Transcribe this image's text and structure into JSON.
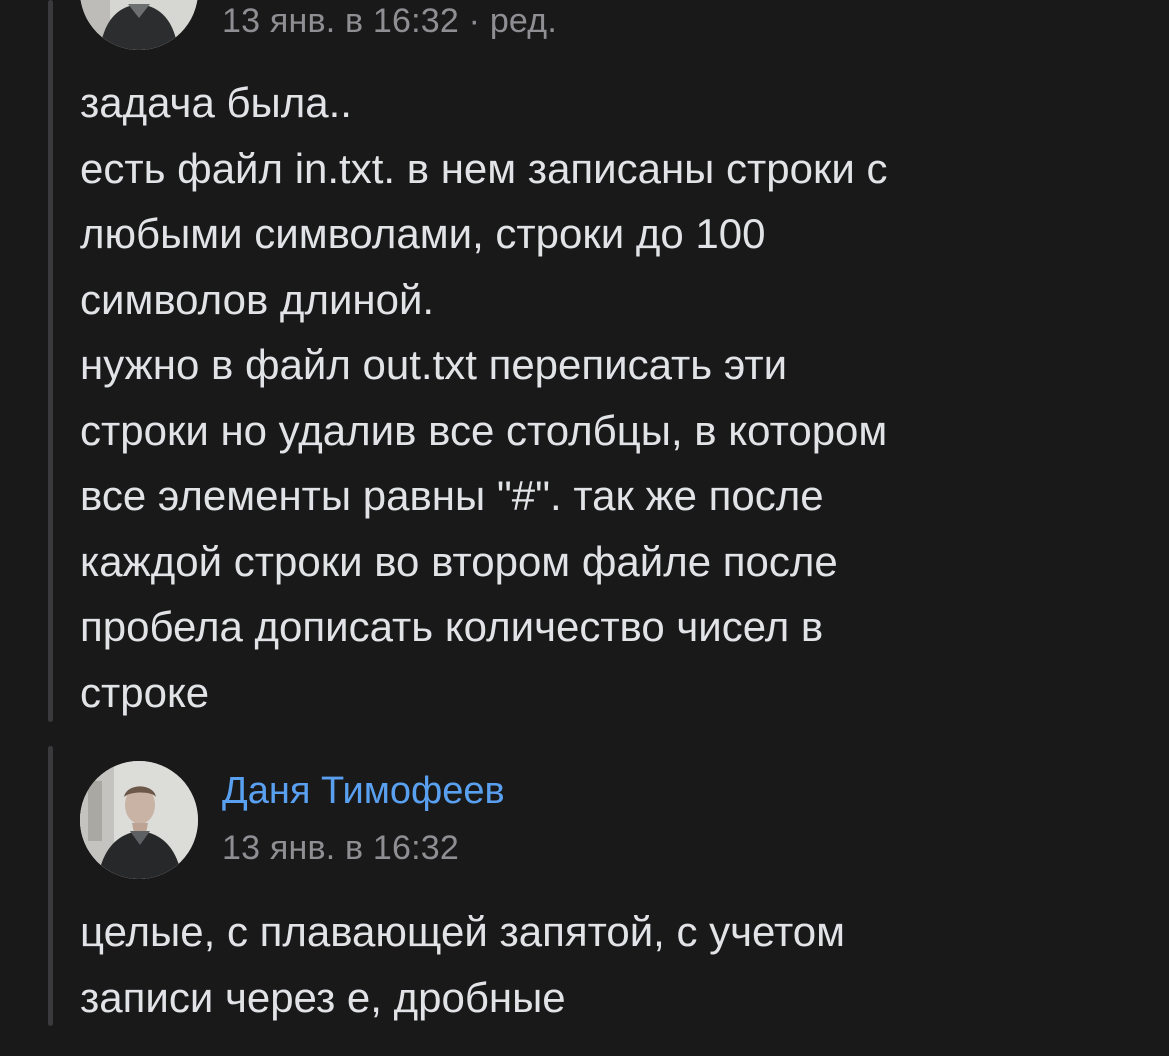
{
  "comments": [
    {
      "timestamp": "13 янв. в 16:32 · ред.",
      "text": "задача была..\nесть файл in.txt. в нем записаны строки с\nлюбыми символами, строки до 100\nсимволов длиной.\nнужно в файл out.txt переписать эти\nстроки но удалив все столбцы, в котором\nвсе элементы равны \"#\". так же после\nкаждой строки во втором файле после\nпробела дописать количество чисел в\nстроке"
    },
    {
      "author": "Даня Тимофеев",
      "timestamp": "13 янв. в 16:32",
      "text": "целые, с плавающей запятой, с учетом\nзаписи через е, дробные"
    }
  ],
  "colors": {
    "background": "#19191a",
    "text": "#e1e3e6",
    "secondary": "#8e8e93",
    "author": "#5aa0f0",
    "thread_line": "#3a3a3c"
  }
}
